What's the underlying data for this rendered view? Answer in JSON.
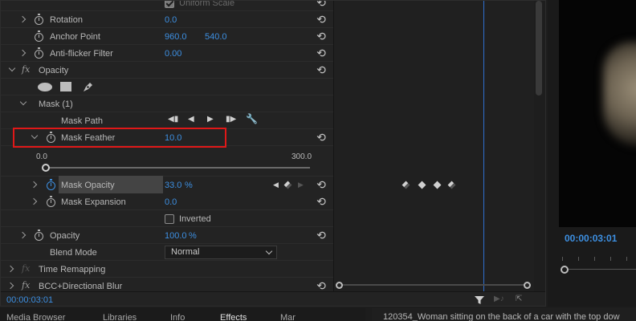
{
  "effect_controls": {
    "uniform_scale_label": "Uniform Scale",
    "rotation": {
      "label": "Rotation",
      "value": "0.0"
    },
    "anchor_point": {
      "label": "Anchor Point",
      "x": "960.0",
      "y": "540.0"
    },
    "anti_flicker": {
      "label": "Anti-flicker Filter",
      "value": "0.00"
    },
    "opacity_section": {
      "fx": "fx",
      "label": "Opacity"
    },
    "mask": {
      "label": "Mask (1)"
    },
    "mask_path": {
      "label": "Mask Path"
    },
    "mask_feather": {
      "label": "Mask Feather",
      "value": "10.0",
      "slider_min": "0.0",
      "slider_max": "300.0",
      "slider_fraction": 0.0
    },
    "mask_opacity": {
      "label": "Mask Opacity",
      "value": "33.0",
      "unit": "%"
    },
    "mask_expansion": {
      "label": "Mask Expansion",
      "value": "0.0"
    },
    "inverted": {
      "label": "Inverted",
      "checked": false
    },
    "opacity": {
      "label": "Opacity",
      "value": "100.0",
      "unit": "%"
    },
    "blend_mode": {
      "label": "Blend Mode",
      "selected": "Normal"
    },
    "time_remapping": {
      "fx": "fx",
      "label": "Time Remapping"
    },
    "bcc_directional_blur": {
      "fx": "fx",
      "label": "BCC+Directional Blur"
    },
    "timecode": "00:00:03:01"
  },
  "bottom_tabs": [
    "Media Browser",
    "Libraries",
    "Info",
    "Effects",
    "Mar"
  ],
  "active_tab": "Effects",
  "media_caption": "120354_Woman sitting on the back of a car with the top dow",
  "program_monitor": {
    "timecode": "00:00:03:01"
  },
  "icons": {
    "reset": "reset-parameter-icon",
    "stopwatch": "stopwatch-icon",
    "filter": "filter-icon"
  },
  "colors": {
    "accent": "#3d8fe1",
    "highlight": "#e01818",
    "playhead": "#2f6fcf"
  }
}
